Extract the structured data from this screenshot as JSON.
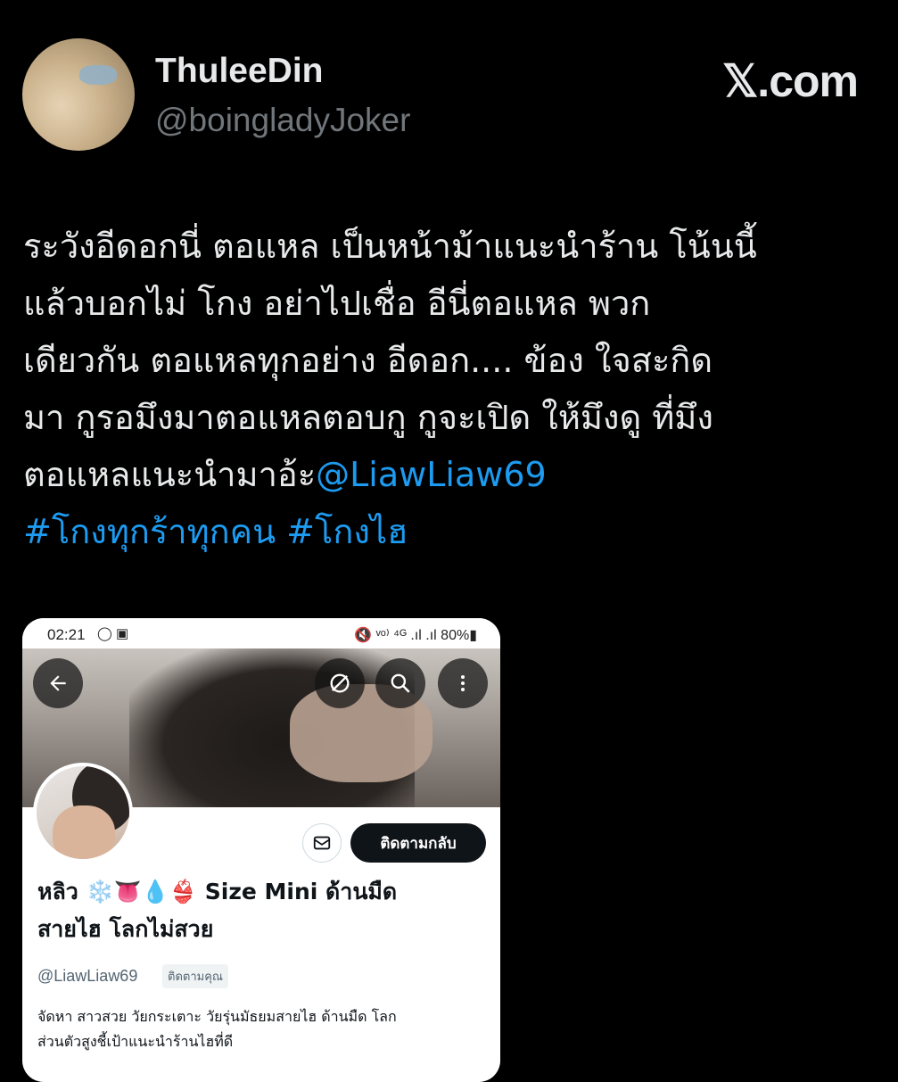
{
  "tweet": {
    "display_name": "ThuleeDin",
    "handle": "@boingladyJoker",
    "brand": "𝕏.com",
    "lines": [
      "ระวังอีดอกนี่ ตอแหล เป็นหน้าม้าแนะนำร้าน โน้นนี้",
      "แล้วบอกไม่ โกง อย่าไปเชื่อ อีนี่ตอแหล พวก",
      "เดียวกัน ตอแหลทุกอย่าง อีดอก.... ข้อง ใจสะกิด",
      "มา กูรอมึงมาตอแหลตอบกู กูจะเปิด ให้มึงดู ที่มึง",
      "ตอแหลแนะนำมาอ้ะ"
    ],
    "mention": "@LiawLiaw69",
    "hashtags": "#โกงทุกร้าทุกคน #โกงไฮ"
  },
  "screenshot": {
    "status_time": "02:21",
    "status_left_icons": "◯ ▣",
    "status_right": "🔇 ᵛᵒ⁾ ⁴ᴳ .ıl .ıl 80%▮",
    "follow_button": "ติดตามกลับ",
    "name_line1": "หลิว ❄️👅💧👙 Size Mini ด้านมืด",
    "name_line2": "สายไฮ โลกไม่สวย",
    "handle": "@LiawLiaw69",
    "follows_you": "ติดตามคุณ",
    "bio_line1": "จัดหา สาวสวย วัยกระเตาะ วัยรุ่นมัธยมสายไฮ ด้านมืด โลก",
    "bio_line2": "ส่วนตัวสูงชี้เป้าแนะนำร้านไฮที่ดี"
  }
}
